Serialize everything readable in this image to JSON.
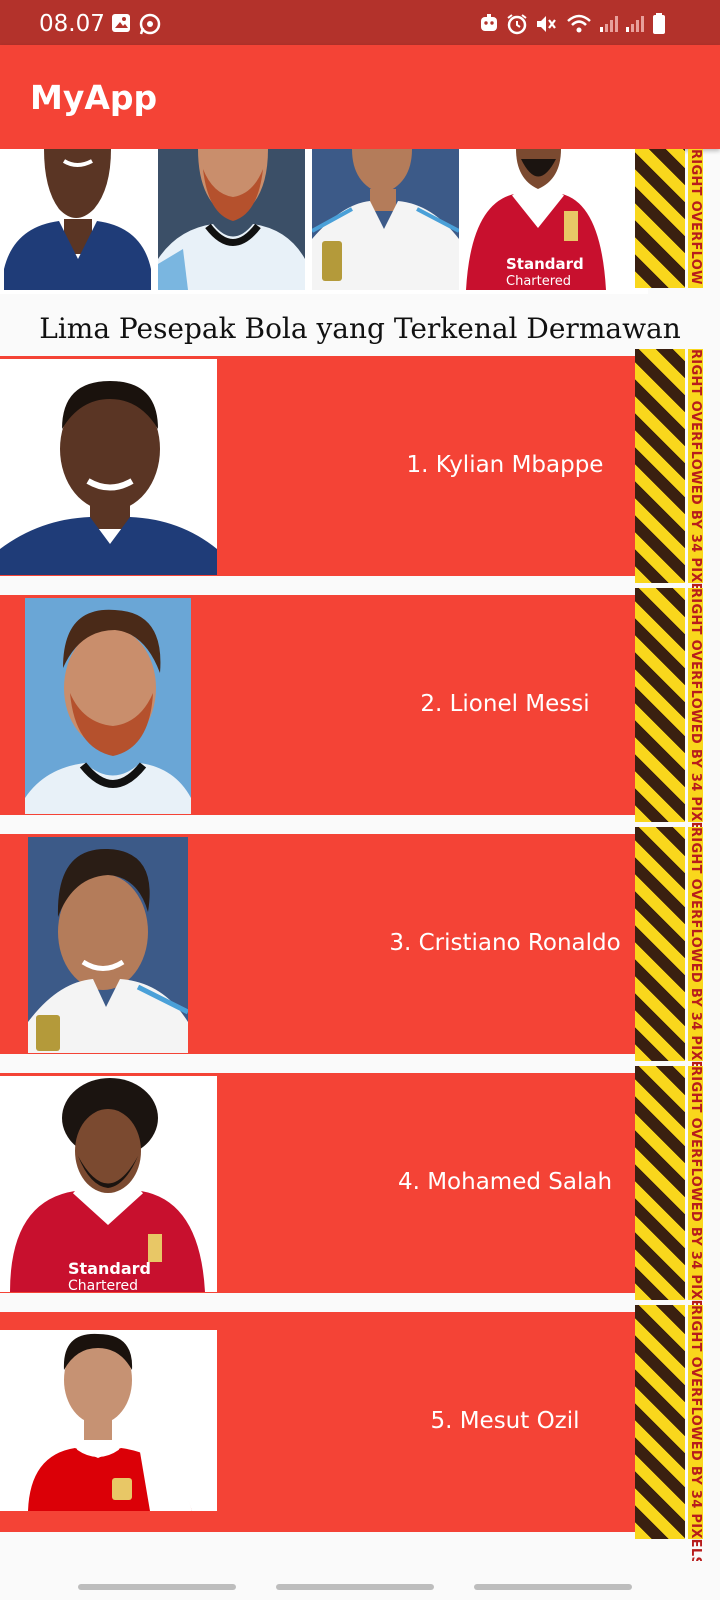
{
  "status_bar": {
    "time": "08.07",
    "left_icons": [
      "gallery-icon",
      "whatsapp-icon"
    ],
    "right_icons": [
      "robot-icon",
      "alarm-icon",
      "mute-icon",
      "wifi-icon",
      "signal-icon",
      "signal-icon",
      "battery-icon"
    ]
  },
  "app_bar": {
    "title": "MyApp"
  },
  "carousel": {
    "players": [
      "Kylian Mbappe",
      "Lionel Messi",
      "Cristiano Ronaldo",
      "Mohamed Salah"
    ],
    "overflow_label": "RIGHT OVERFLOW"
  },
  "heading": "Lima Pesepak Bola yang Terkenal Dermawan",
  "players": [
    {
      "label": "1. Kylian Mbappe",
      "jersey": "#1f3c78",
      "photo_bg": "#ffffff"
    },
    {
      "label": "2. Lionel Messi",
      "jersey": "#e8f1f8",
      "photo_bg": "#6aa6d6"
    },
    {
      "label": "3. Cristiano Ronaldo",
      "jersey": "#f4f4f4",
      "photo_bg": "#3c5a88"
    },
    {
      "label": "4. Mohamed Salah",
      "jersey": "#c8102e",
      "photo_bg": "#ffffff"
    },
    {
      "label": "5. Mesut Ozil",
      "jersey": "#db0007",
      "photo_bg": "#ffffff"
    }
  ],
  "overflow_warning": "RIGHT OVERFLOWED BY 34 PIXELS",
  "colors": {
    "primary": "#f44336",
    "status_bar": "#b3322b",
    "warning_yellow": "#f9d71c",
    "warning_dark": "#3a2010"
  }
}
